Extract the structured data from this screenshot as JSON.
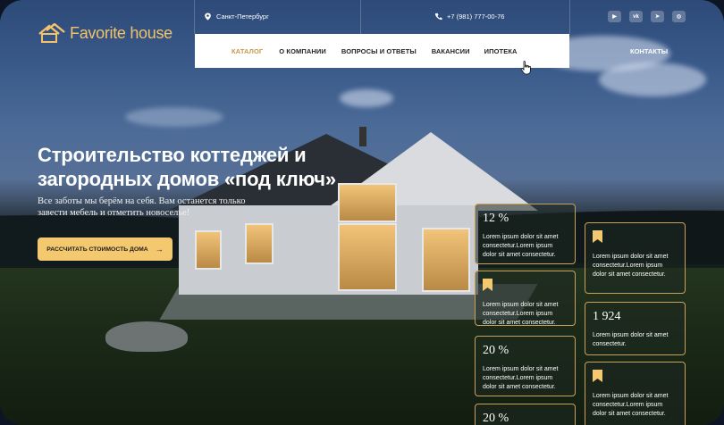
{
  "brand": {
    "name": "Favorite house"
  },
  "header": {
    "city": "Санкт-Петербург",
    "phone": "+7 (981) 777-00-76",
    "socials": [
      {
        "icon": "youtube-icon",
        "glyph": "▶"
      },
      {
        "icon": "vk-icon",
        "glyph": "vk"
      },
      {
        "icon": "telegram-icon",
        "glyph": "➤"
      },
      {
        "icon": "instagram-icon",
        "glyph": "◎"
      }
    ],
    "contacts": "Контакты"
  },
  "nav": {
    "items": [
      {
        "label": "Каталог",
        "active": true
      },
      {
        "label": "О компании",
        "active": false
      },
      {
        "label": "Вопросы и ответы",
        "active": false
      },
      {
        "label": "Вакансии",
        "active": false
      },
      {
        "label": "Ипотека",
        "active": false
      }
    ]
  },
  "hero": {
    "title": "Строительство коттеджей и загородных домов «под ключ»",
    "subtitle": "Все заботы мы берём на себя. Вам останется только завести мебель и отметить новоселье!",
    "cta": "Рассчитать стоимость дома"
  },
  "cards": {
    "left": [
      {
        "type": "stat",
        "stat": "12 %",
        "text": "Lorem ipsum dolor sit amet consectetur.Lorem ipsum dolor sit amet consectetur."
      },
      {
        "type": "bookmark",
        "text": "Lorem ipsum dolor sit amet consectetur.Lorem ipsum dolor sit amet consectetur."
      },
      {
        "type": "stat",
        "stat": "20 %",
        "text": "Lorem ipsum dolor sit amet consectetur.Lorem ipsum dolor sit amet consectetur."
      },
      {
        "type": "stat",
        "stat": "20 %",
        "text": ""
      }
    ],
    "right": [
      {
        "type": "bookmark",
        "text": "Lorem ipsum dolor sit amet consectetur.Lorem ipsum dolor sit amet consectetur."
      },
      {
        "type": "stat",
        "stat": "1 924",
        "text": "Lorem ipsum dolor sit amet consectetur."
      },
      {
        "type": "bookmark",
        "text": "Lorem ipsum dolor sit amet consectetur.Lorem ipsum dolor sit amet consectetur."
      }
    ]
  },
  "colors": {
    "accent": "#f4c86e",
    "gold_border": "#c9a15a",
    "nav_active": "#c39a4b"
  }
}
